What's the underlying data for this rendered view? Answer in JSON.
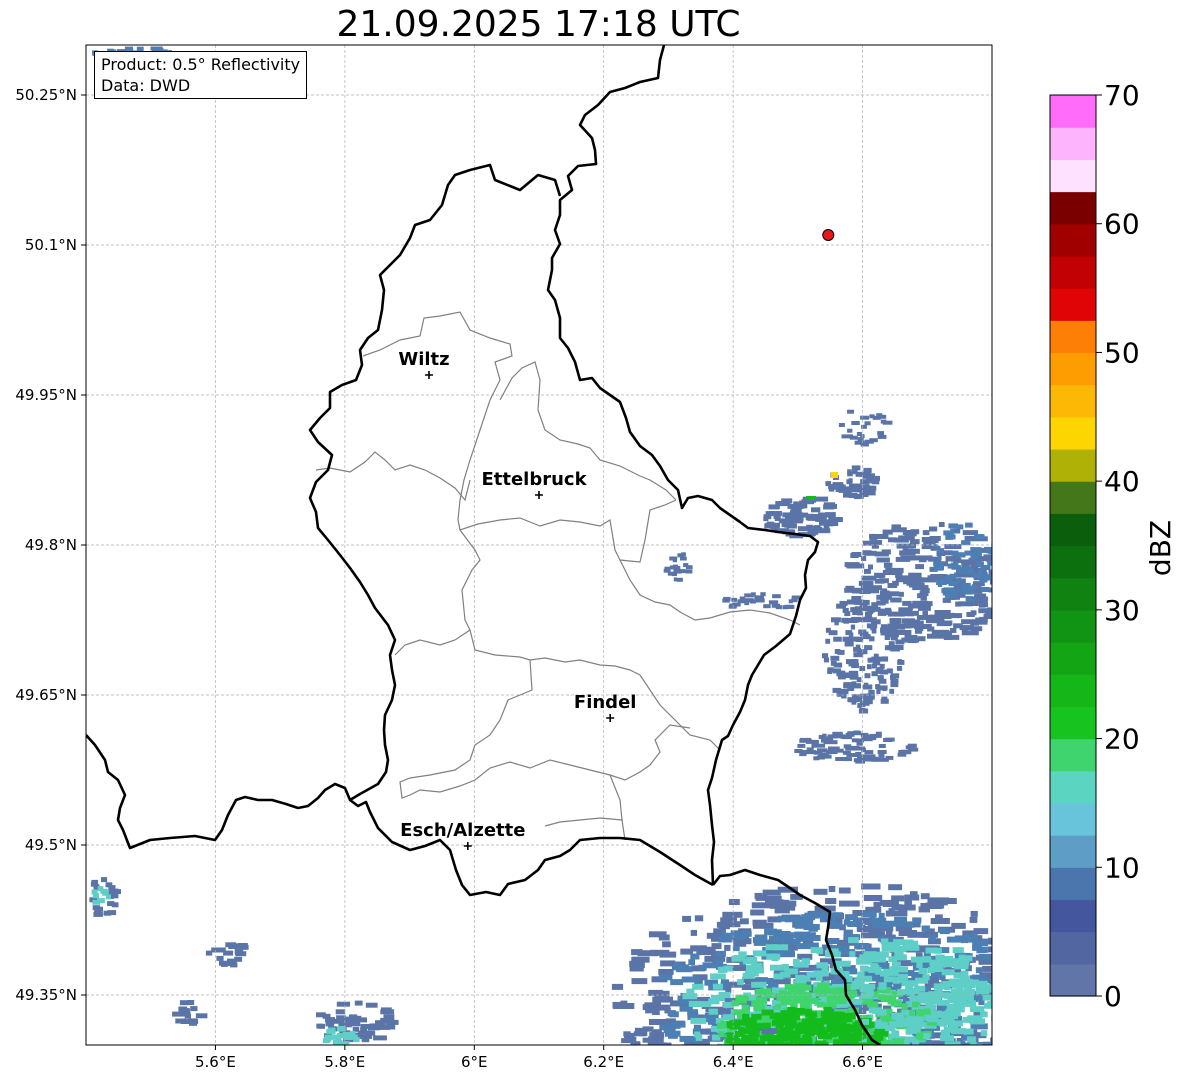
{
  "title": "21.09.2025 17:18 UTC",
  "info": {
    "product": "Product: 0.5° Reflectivity",
    "source": "Data: DWD"
  },
  "axes": {
    "lon_ticks": [
      "5.6°E",
      "5.8°E",
      "6°E",
      "6.2°E",
      "6.4°E",
      "6.6°E"
    ],
    "lat_ticks": [
      "50.25°N",
      "50.1°N",
      "49.95°N",
      "49.8°N",
      "49.65°N",
      "49.5°N",
      "49.35°N"
    ],
    "lon_values": [
      5.6,
      5.8,
      6.0,
      6.2,
      6.4,
      6.6
    ],
    "lat_values": [
      50.25,
      50.1,
      49.95,
      49.8,
      49.65,
      49.5,
      49.35
    ],
    "lon_range": [
      5.4,
      6.8
    ],
    "lat_range": [
      49.3,
      50.3
    ],
    "grid": true
  },
  "cities": [
    {
      "name": "Wiltz",
      "lon": 5.93,
      "lat": 49.97
    },
    {
      "name": "Ettelbruck",
      "lon": 6.1,
      "lat": 49.85
    },
    {
      "name": "Findel",
      "lon": 6.21,
      "lat": 49.627
    },
    {
      "name": "Esch/Alzette",
      "lon": 5.99,
      "lat": 49.499
    }
  ],
  "radar_site": {
    "lon": 6.547,
    "lat": 50.11,
    "color": "#e8161b"
  },
  "colorbar": {
    "label": "dBZ",
    "ticks": [
      "0",
      "10",
      "20",
      "30",
      "40",
      "50",
      "60",
      "70"
    ],
    "min": 0,
    "max": 70,
    "step": 2.5,
    "colors": [
      "#6175a8",
      "#5267a1",
      "#44579e",
      "#4a76ad",
      "#5d9dc6",
      "#67c4db",
      "#5cd4c2",
      "#3fd46e",
      "#17c41f",
      "#15b617",
      "#13a514",
      "#119313",
      "#0f8212",
      "#0c700f",
      "#0a5e0c",
      "#44761a",
      "#afb106",
      "#fdd501",
      "#fdb806",
      "#fe9d02",
      "#fd7f05",
      "#e10406",
      "#c10103",
      "#a00000",
      "#7a0000",
      "#fee1fe",
      "#feb3fd",
      "#fe6cf9",
      "#e935ec"
    ]
  },
  "echo_colors": {
    "weak": "#5a74a8",
    "light": "#4c7fb4",
    "moderate": "#5ecfc6",
    "green": "#3fd46e",
    "strong": "#14bb1c",
    "yellow": "#fdd501"
  }
}
